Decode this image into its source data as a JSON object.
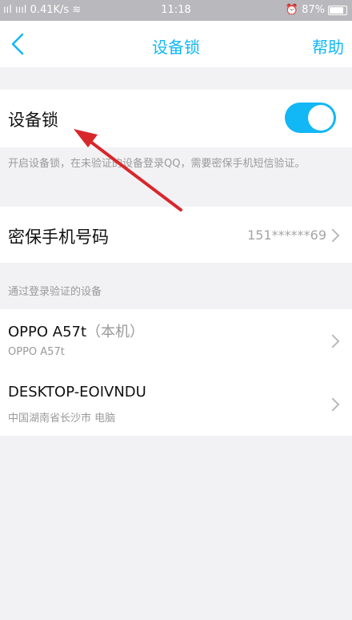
{
  "status_bar": {
    "signal": "ııl ıııl",
    "speed": "0.41K/s",
    "time": "11:18",
    "battery": "87%"
  },
  "nav": {
    "title": "设备锁",
    "help": "帮助"
  },
  "device_lock": {
    "label": "设备锁",
    "enabled": true,
    "hint": "开启设备锁，在未验证的设备登录QQ，需要密保手机短信验证。"
  },
  "phone": {
    "label": "密保手机号码",
    "value": "151******69"
  },
  "verified_devices": {
    "header": "通过登录验证的设备",
    "items": [
      {
        "name": "OPPO A57t",
        "suffix": "（本机）",
        "sub": "OPPO A57t"
      },
      {
        "name": "DESKTOP-EOIVNDU",
        "suffix": "",
        "sub": "中国湖南省长沙市 电脑"
      }
    ]
  },
  "colors": {
    "accent": "#12b7f5",
    "arrow": "#d8272b"
  }
}
